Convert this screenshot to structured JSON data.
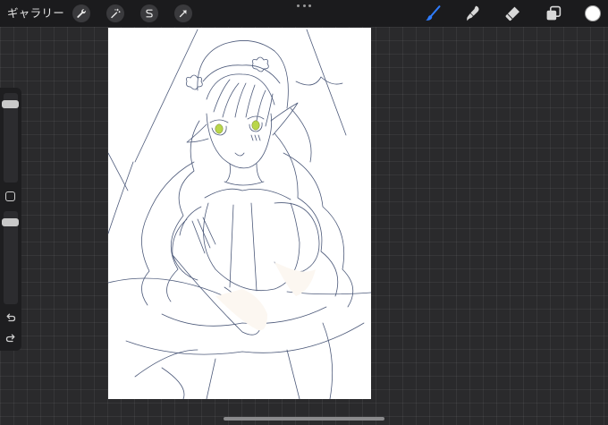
{
  "topbar": {
    "gallery_label": "ギャラリー",
    "left_tools": [
      {
        "name": "actions",
        "icon": "wrench-icon"
      },
      {
        "name": "adjustments",
        "icon": "magic-wand-icon"
      },
      {
        "name": "selection",
        "icon": "selection-s-icon"
      },
      {
        "name": "transform",
        "icon": "arrow-cursor-icon"
      }
    ],
    "right_tools": [
      {
        "name": "brush",
        "icon": "brush-icon",
        "active": true
      },
      {
        "name": "smudge",
        "icon": "smudge-icon",
        "active": false
      },
      {
        "name": "eraser",
        "icon": "eraser-icon",
        "active": false
      },
      {
        "name": "layers",
        "icon": "layers-icon",
        "active": false
      }
    ],
    "active_color": "#ffffff",
    "accent_color": "#2f7dff"
  },
  "sidebar": {
    "brush_size_level": 0.9,
    "opacity_level": 0.9,
    "undo_icon": "undo-icon",
    "redo_icon": "redo-icon"
  },
  "canvas": {
    "line_color": "#4d5a7a",
    "eye_color": "#b9d64a",
    "skin_tint": "#fcf7f1"
  }
}
